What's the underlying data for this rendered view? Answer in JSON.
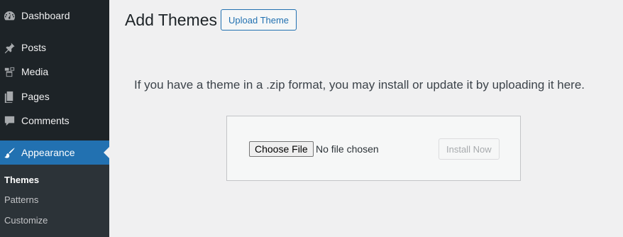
{
  "sidebar": {
    "items": [
      {
        "label": "Dashboard",
        "icon": "dashboard-icon"
      },
      {
        "label": "Posts",
        "icon": "pin-icon"
      },
      {
        "label": "Media",
        "icon": "media-icon"
      },
      {
        "label": "Pages",
        "icon": "pages-icon"
      },
      {
        "label": "Comments",
        "icon": "comment-icon"
      },
      {
        "label": "Appearance",
        "icon": "brush-icon",
        "current": true
      }
    ],
    "submenu": [
      {
        "label": "Themes",
        "current": true
      },
      {
        "label": "Patterns"
      },
      {
        "label": "Customize"
      }
    ]
  },
  "header": {
    "title": "Add Themes",
    "upload_label": "Upload Theme"
  },
  "main": {
    "help_text": "If you have a theme in a .zip format, you may install or update it by uploading it here.",
    "choose_file_label": "Choose File",
    "file_status": "No file chosen",
    "install_label": "Install Now"
  },
  "colors": {
    "sidebar_bg": "#1d2327",
    "submenu_bg": "#2c3338",
    "accent": "#2271b1",
    "page_bg": "#f0f0f1"
  }
}
